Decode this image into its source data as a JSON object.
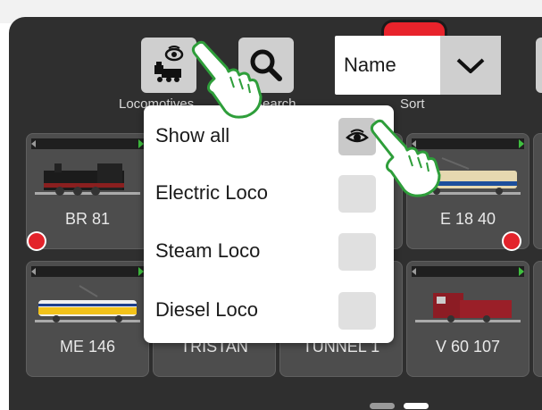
{
  "toolbar": {
    "locomotives_label": "Locomotives",
    "search_label": "Search",
    "sort_label": "Sort",
    "sort_value": "Name"
  },
  "filter_popup": {
    "items": [
      {
        "label": "Show all",
        "selected": true,
        "icon": "eye-icon"
      },
      {
        "label": "Electric Loco",
        "selected": false
      },
      {
        "label": "Steam Loco",
        "selected": false
      },
      {
        "label": "Diesel Loco",
        "selected": false
      }
    ]
  },
  "locomotives": [
    {
      "name": "BR 81",
      "type": "steam",
      "alert": true
    },
    {
      "name": "",
      "type": "hidden",
      "alert": false
    },
    {
      "name": "",
      "type": "hidden",
      "alert": false
    },
    {
      "name": "E 18 40",
      "type": "electric",
      "alert": true
    },
    {
      "name": "ME 146",
      "type": "electric",
      "alert": false
    },
    {
      "name": "TRISTAN",
      "type": "hidden",
      "alert": false
    },
    {
      "name": "TUNNEL 1",
      "type": "hidden",
      "alert": false
    },
    {
      "name": "V 60 107",
      "type": "diesel",
      "alert": false
    }
  ],
  "colors": {
    "screen_bg": "#2f2f2f",
    "button_gray": "#cfcfcf",
    "status_red": "#e8232b",
    "progress_green": "#3fbf3f",
    "hand_outline": "#2e9e3a"
  },
  "pager": {
    "pages": 2,
    "current": 2
  }
}
